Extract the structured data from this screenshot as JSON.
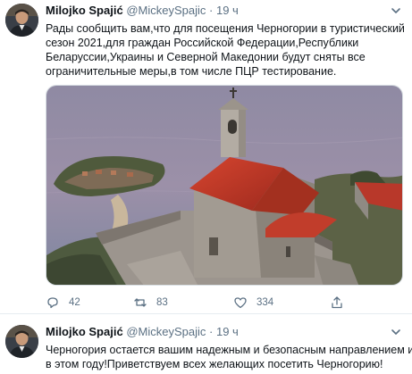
{
  "tweets": [
    {
      "author_name": "Milojko Spajić",
      "handle": "@MickeySpajic",
      "separator": "·",
      "time": "19 ч",
      "text_lines": [
        "Рады сообщить вам,что для посещения Черногории в туристический",
        "сезон 2021,для граждан Российской Федерации,Республики",
        "Беларуссии,Украины и Северной Македонии будут сняты все",
        "ограничительные меры,в том числе ПЦР тестирование."
      ],
      "stats": {
        "replies": "42",
        "retweets": "83",
        "likes": "334"
      }
    },
    {
      "author_name": "Milojko Spajić",
      "handle": "@MickeySpajic",
      "separator": "·",
      "time": "19 ч",
      "text_lines": [
        "Черногория остается вашим надежным и безопасным направлением и",
        "в этом году!Приветствуем всех желающих посетить Черногорию!"
      ]
    }
  ],
  "icons": {
    "reply": "reply-icon",
    "retweet": "retweet-icon",
    "like": "heart-icon",
    "share": "share-icon",
    "more": "chevron-down-icon"
  },
  "colors": {
    "text": "#0f1419",
    "secondary": "#5b7083",
    "divider": "#e6ecf0",
    "roof": "#c0392b"
  }
}
